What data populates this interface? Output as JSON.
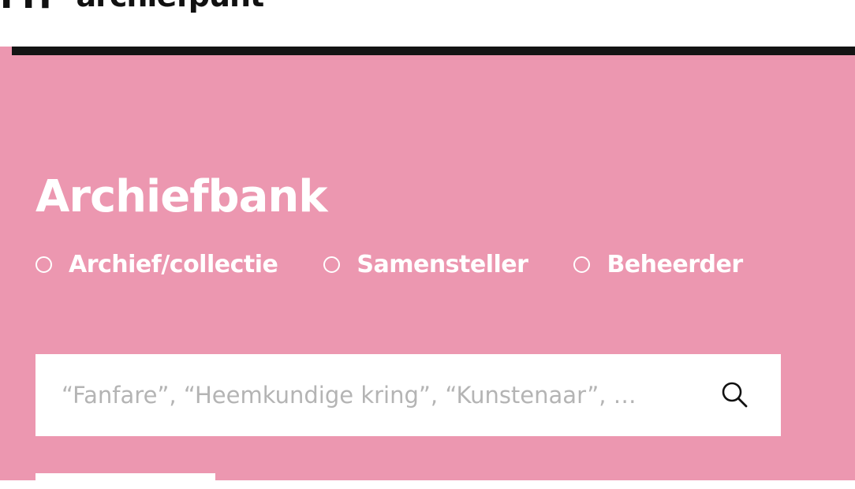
{
  "header": {
    "logo_mark": "FIT",
    "logo_text": "archiefpunt"
  },
  "main": {
    "title": "Archiefbank",
    "radio_options": [
      {
        "label": "Archief/collectie",
        "selected": false
      },
      {
        "label": "Samensteller",
        "selected": false
      },
      {
        "label": "Beheerder",
        "selected": false
      }
    ],
    "search": {
      "placeholder": "“Fanfare”, “Heemkundige kring”, “Kunstenaar”, …",
      "value": "",
      "icon": "search-icon"
    }
  },
  "colors": {
    "background_pink": "#ec97b0",
    "header_bar": "#141414",
    "text_white": "#ffffff",
    "placeholder_gray": "#b4b4b4"
  }
}
